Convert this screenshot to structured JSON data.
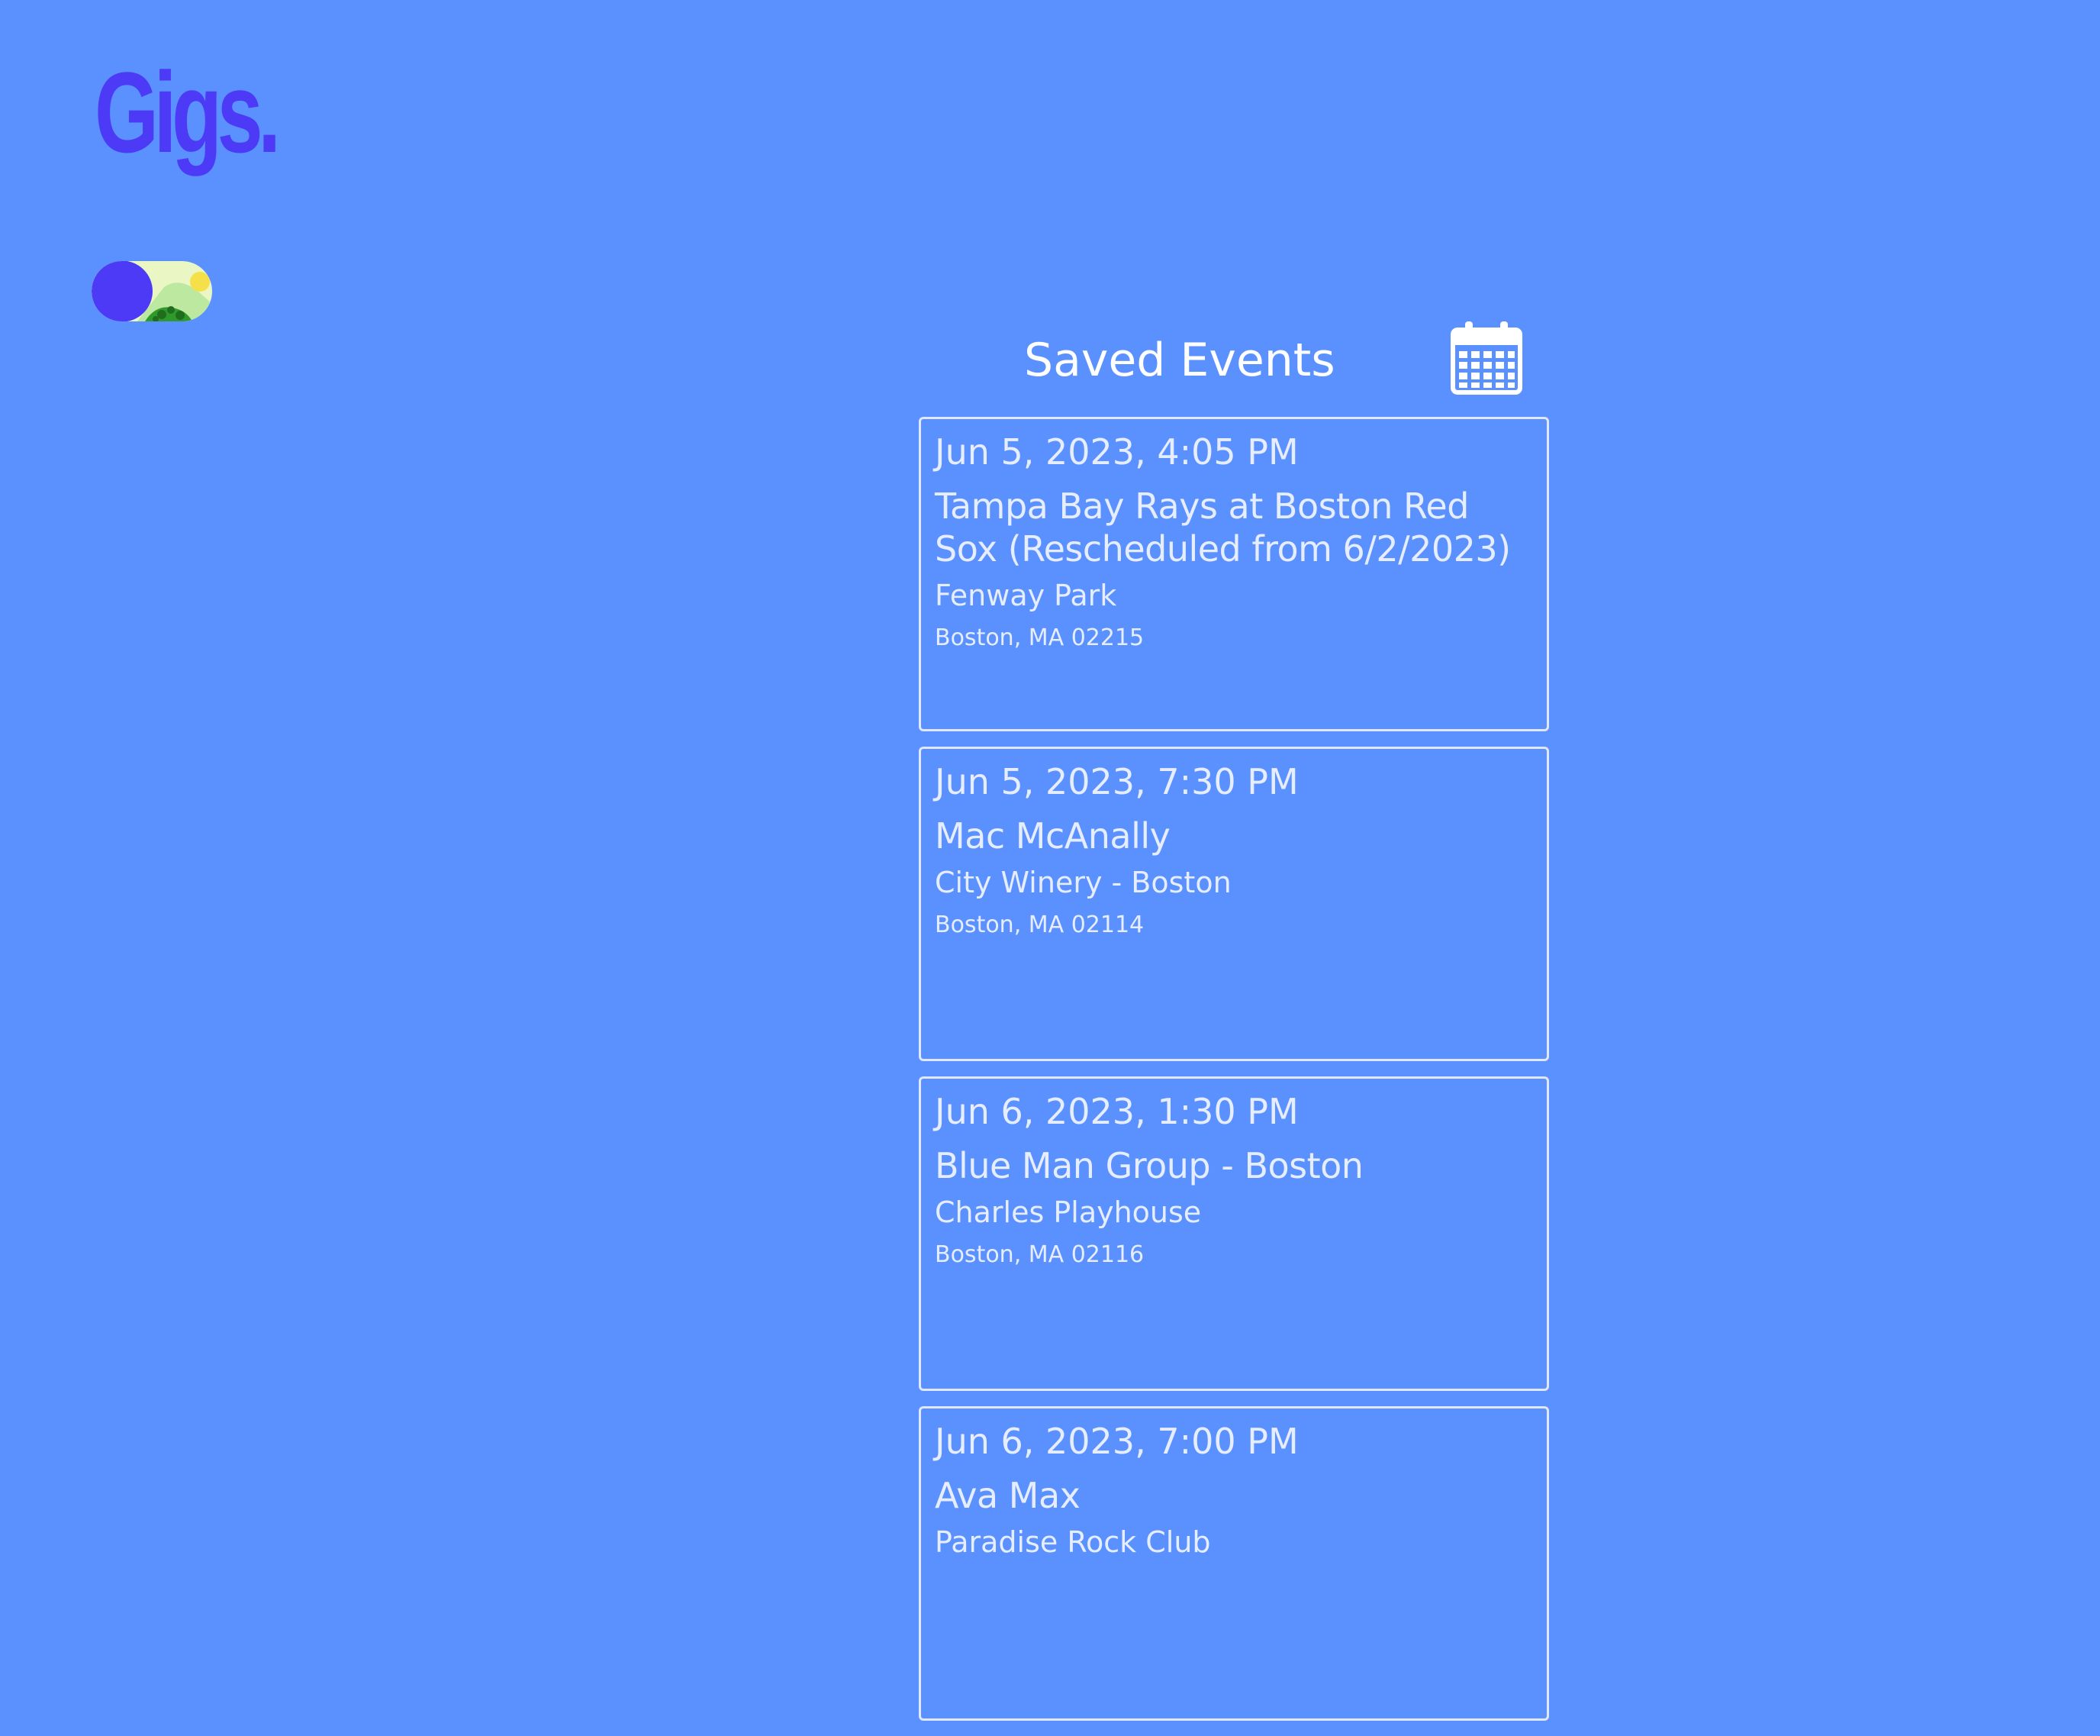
{
  "app": {
    "logo": "Gigs."
  },
  "theme_toggle": {
    "state": "day"
  },
  "saved_events": {
    "title": "Saved Events",
    "icon": "calendar-icon",
    "events": [
      {
        "date": "Jun 5, 2023, 4:05 PM",
        "name": "Tampa Bay Rays at Boston Red Sox (Rescheduled from 6/2/2023)",
        "venue": "Fenway Park",
        "address": "Boston, MA 02215"
      },
      {
        "date": "Jun 5, 2023, 7:30 PM",
        "name": "Mac McAnally",
        "venue": "City Winery - Boston",
        "address": "Boston, MA 02114"
      },
      {
        "date": "Jun 6, 2023, 1:30 PM",
        "name": "Blue Man Group - Boston",
        "venue": "Charles Playhouse",
        "address": "Boston, MA 02116"
      },
      {
        "date": "Jun 6, 2023, 7:00 PM",
        "name": "Ava Max",
        "venue": "Paradise Rock Club",
        "address": ""
      }
    ]
  },
  "colors": {
    "background": "#5b91fe",
    "logo": "#4c3af6",
    "text": "#ffffff",
    "card_border": "#dfe8ff"
  }
}
